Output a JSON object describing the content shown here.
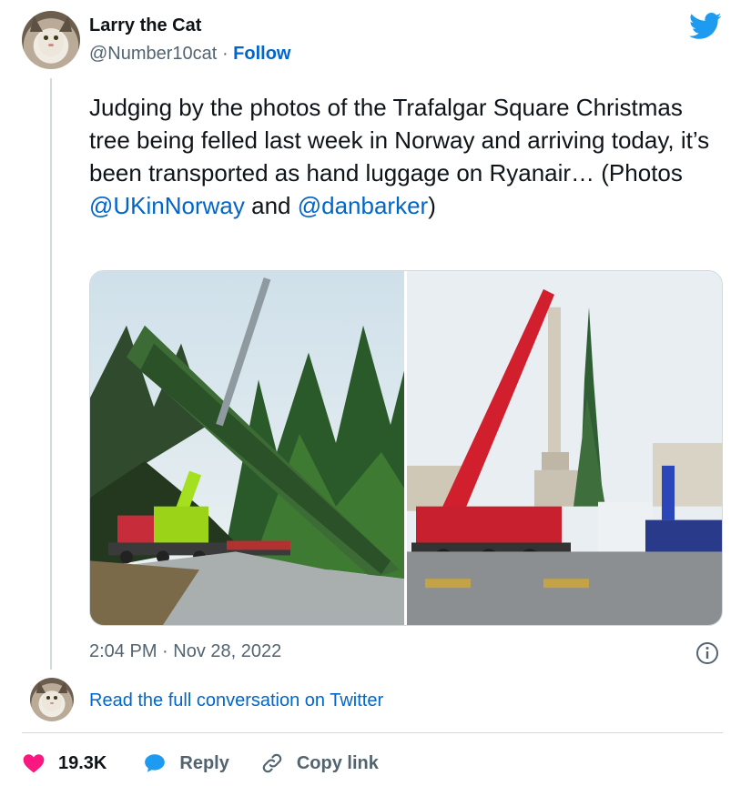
{
  "author": {
    "name": "Larry the Cat",
    "handle": "@Number10cat",
    "separator": "·",
    "follow_label": "Follow"
  },
  "tweet": {
    "text_segments": [
      "Judging by the photos of the Trafalgar Square Christmas tree being felled last week in Norway and arriving today, it’s been transported as hand luggage on Ryanair… (Photos ",
      " and",
      ")"
    ],
    "mentions": [
      "@UKinNorway",
      "@danbarker"
    ],
    "timestamp": "2:04 PM · Nov 28, 2022"
  },
  "media": {
    "photos": [
      {
        "subject": "crane lifting felled tree in Norwegian forest"
      },
      {
        "subject": "tree arriving in Trafalgar Square with cranes"
      }
    ]
  },
  "conversation": {
    "read_link": "Read the full conversation on Twitter"
  },
  "actions": {
    "like_count": "19.3K",
    "reply_label": "Reply",
    "copy_link_label": "Copy link"
  },
  "icons": {
    "brand": "twitter-bird-icon",
    "info": "info-icon",
    "like": "heart-icon",
    "reply": "speech-bubble-icon",
    "copy_link": "link-icon"
  },
  "colors": {
    "brand": "#1d9bf0",
    "link": "#0066cc",
    "like": "#f91880",
    "secondary_text": "#536471",
    "border": "#cfd9de"
  }
}
